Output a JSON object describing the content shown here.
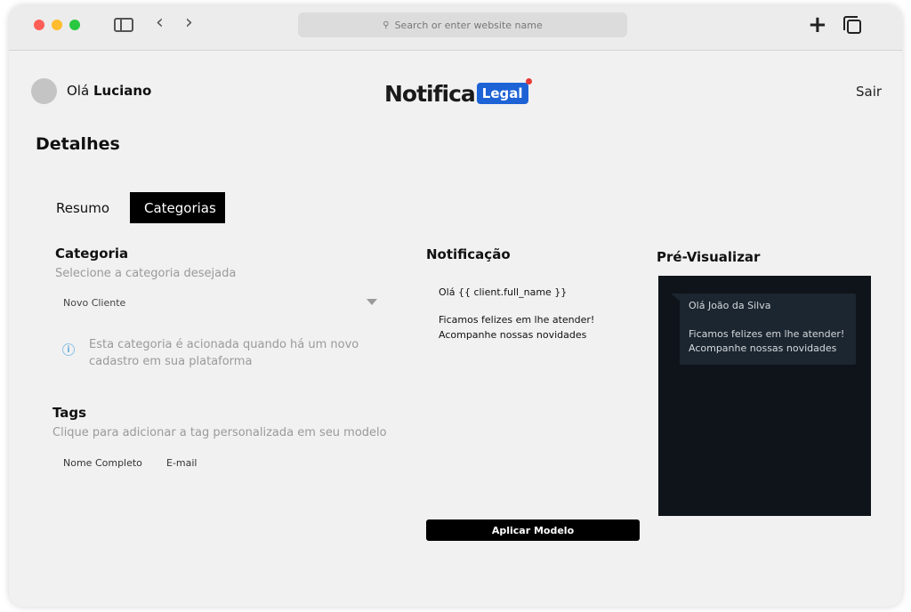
{
  "browser": {
    "address_placeholder": "Search or enter website name"
  },
  "header": {
    "greeting_prefix": "Olá",
    "user_name": "Luciano",
    "logo_main": "Notifica",
    "logo_badge": "Legal",
    "logout_label": "Sair"
  },
  "page": {
    "title": "Detalhes"
  },
  "tabs": [
    {
      "label": "Resumo",
      "active": false
    },
    {
      "label": "Categorias",
      "active": true
    }
  ],
  "category": {
    "label": "Categoria",
    "hint": "Selecione a categoria desejada",
    "selected": "Novo Cliente",
    "info_text": "Esta categoria é acionada quando há um novo cadastro em sua plataforma"
  },
  "tags": {
    "label": "Tags",
    "hint": "Clique para adicionar a tag personalizada em seu modelo",
    "items": [
      "Nome Completo",
      "E-mail"
    ]
  },
  "notification": {
    "label": "Notificação",
    "lines": [
      "Olá {{ client.full_name }}",
      "Ficamos felizes em lhe atender!",
      "Acompanhe nossas novidades"
    ],
    "apply_label": "Aplicar Modelo"
  },
  "preview": {
    "label": "Pré-Visualizar",
    "lines": [
      "Olá João da Silva",
      "Ficamos felizes em lhe atender!",
      "Acompanhe nossas novidades"
    ]
  },
  "colors": {
    "accent": "#1d63d6",
    "active_tab_bg": "#000000",
    "preview_bg": "#0e141a"
  }
}
